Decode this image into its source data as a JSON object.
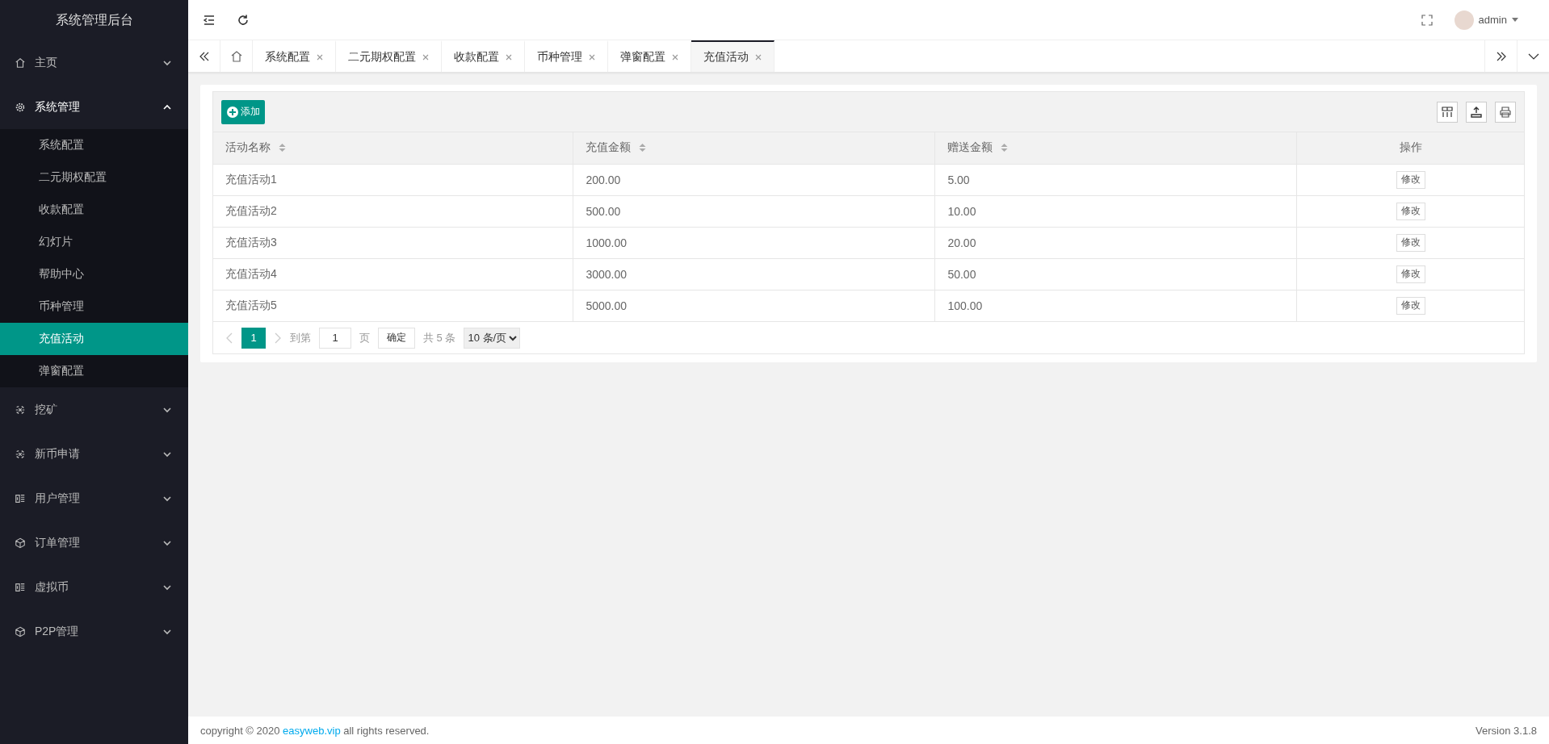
{
  "sidebar": {
    "title": "系统管理后台",
    "items": [
      {
        "label": "主页",
        "kind": "home",
        "expanded": false
      },
      {
        "label": "系统管理",
        "kind": "gear",
        "expanded": true,
        "children": [
          {
            "label": "系统配置",
            "selected": false
          },
          {
            "label": "二元期权配置",
            "selected": false
          },
          {
            "label": "收款配置",
            "selected": false
          },
          {
            "label": "幻灯片",
            "selected": false
          },
          {
            "label": "帮助中心",
            "selected": false
          },
          {
            "label": "币种管理",
            "selected": false
          },
          {
            "label": "充值活动",
            "selected": true
          },
          {
            "label": "弹窗配置",
            "selected": false
          }
        ]
      },
      {
        "label": "挖矿",
        "kind": "bug",
        "expanded": false
      },
      {
        "label": "新币申请",
        "kind": "bug",
        "expanded": false
      },
      {
        "label": "用户管理",
        "kind": "panel",
        "expanded": false
      },
      {
        "label": "订单管理",
        "kind": "cube",
        "expanded": false
      },
      {
        "label": "虚拟币",
        "kind": "panel",
        "expanded": false
      },
      {
        "label": "P2P管理",
        "kind": "cube",
        "expanded": false
      }
    ]
  },
  "header": {
    "user": "admin"
  },
  "tabs": [
    {
      "label": "系统配置",
      "selected": false
    },
    {
      "label": "二元期权配置",
      "selected": false
    },
    {
      "label": "收款配置",
      "selected": false
    },
    {
      "label": "币种管理",
      "selected": false
    },
    {
      "label": "弹窗配置",
      "selected": false
    },
    {
      "label": "充值活动",
      "selected": true
    }
  ],
  "toolbar": {
    "add_button": "添加"
  },
  "table": {
    "columns": [
      "活动名称",
      "充值金额",
      "赠送金额",
      "操作"
    ],
    "rows": [
      {
        "cells": [
          "充值活动1",
          "200.00",
          "5.00"
        ],
        "action": "修改"
      },
      {
        "cells": [
          "充值活动2",
          "500.00",
          "10.00"
        ],
        "action": "修改"
      },
      {
        "cells": [
          "充值活动3",
          "1000.00",
          "20.00"
        ],
        "action": "修改"
      },
      {
        "cells": [
          "充值活动4",
          "3000.00",
          "50.00"
        ],
        "action": "修改"
      },
      {
        "cells": [
          "充值活动5",
          "5000.00",
          "100.00"
        ],
        "action": "修改"
      }
    ]
  },
  "pagination": {
    "pages": [
      {
        "label": "1",
        "selected": true
      }
    ],
    "goto_label": "到第",
    "goto_value": "1",
    "page_unit": "页",
    "confirm": "确定",
    "total": "共 5 条",
    "page_size": "10 条/页"
  },
  "footer": {
    "copyright_before": "copyright © 2020 ",
    "link": "easyweb.vip",
    "copyright_after": " all rights reserved.",
    "version": "Version 3.1.8"
  }
}
